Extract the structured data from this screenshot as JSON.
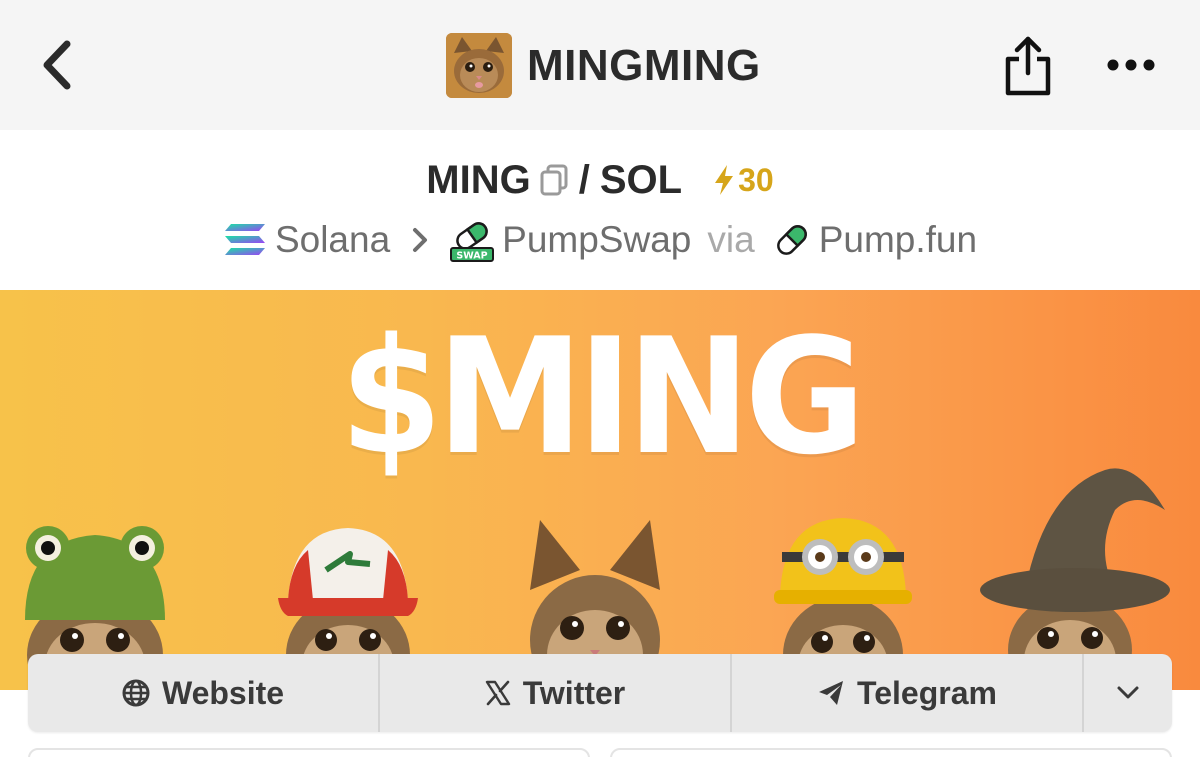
{
  "header": {
    "app_title": "MINGMING",
    "back_icon": "chevron-left-icon",
    "share_icon": "share-icon",
    "more_icon": "more-horizontal-icon"
  },
  "pair": {
    "base": "MING",
    "separator": "/",
    "quote": "SOL",
    "boost_count": "30",
    "boost_color": "#d6a51a"
  },
  "route": {
    "chain": "Solana",
    "dex": "PumpSwap",
    "via_label": "via",
    "launchpad": "Pump.fun"
  },
  "banner": {
    "title": "$MING"
  },
  "links": {
    "website": "Website",
    "twitter": "Twitter",
    "telegram": "Telegram"
  }
}
